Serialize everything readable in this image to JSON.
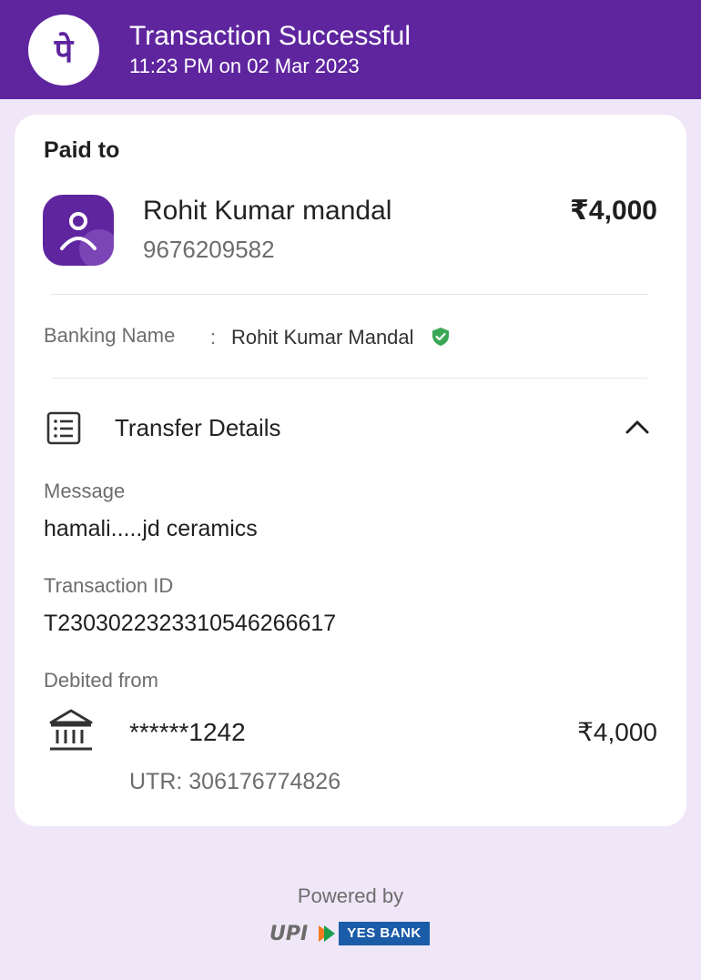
{
  "header": {
    "title": "Transaction Successful",
    "timestamp": "11:23 PM on 02 Mar 2023",
    "logo_glyph": "पे",
    "brand_color": "#5f259f"
  },
  "payee": {
    "section_label": "Paid to",
    "name": "Rohit Kumar mandal",
    "phone": "9676209582",
    "amount": "₹4,000",
    "avatar_icon": "person-icon"
  },
  "banking": {
    "label": "Banking Name",
    "separator": ":",
    "value": "Rohit Kumar Mandal",
    "verified_icon": "verified-shield-icon",
    "verified_color": "#3aa757"
  },
  "transfer_details": {
    "title": "Transfer Details",
    "icon": "receipt-list-icon",
    "toggle_icon": "chevron-up-icon",
    "fields": [
      {
        "label": "Message",
        "value": "hamali.....jd ceramics"
      },
      {
        "label": "Transaction ID",
        "value": "T2303022323310546266617"
      }
    ],
    "debited": {
      "label": "Debited from",
      "account": "******1242",
      "amount": "₹4,000",
      "utr": "UTR: 306176774826",
      "icon": "bank-icon"
    }
  },
  "footer": {
    "powered_by": "Powered by",
    "upi_logo": "UPI",
    "bank_logo": "YES BANK"
  }
}
